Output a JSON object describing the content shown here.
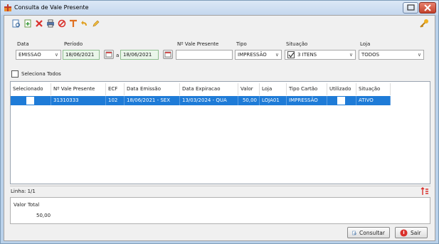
{
  "window": {
    "title": "Consulta de Vale Presente"
  },
  "filters": {
    "data_label": "Data",
    "data_value": "EMISSAO",
    "periodo_label": "Período",
    "periodo_start": "18/06/2021",
    "periodo_sep": "a",
    "periodo_end": "18/06/2021",
    "vale_label": "Nº Vale Presente",
    "vale_value": "",
    "tipo_label": "Tipo",
    "tipo_value": "IMPRESSÃO",
    "situacao_label": "Situação",
    "situacao_value": "3 ITENS",
    "loja_label": "Loja",
    "loja_value": "TODOS"
  },
  "select_all_label": "Seleciona Todos",
  "table": {
    "headers": [
      "Selecionado",
      "Nº Vale Presente",
      "ECF",
      "Data Emissão",
      "Data Expiracao",
      "Valor",
      "Loja",
      "Tipo Cartão",
      "Utilizado",
      "Situação"
    ],
    "rows": [
      {
        "vale": "31310333",
        "ecf": "102",
        "emissao": "18/06/2021 - SEX",
        "expiracao": "13/03/2024 - QUA",
        "valor": "50,00",
        "loja": "LOJA01",
        "tipo": "IMPRESSÃO",
        "situacao": "ATIVO"
      }
    ]
  },
  "status": {
    "linha": "Linha: 1/1"
  },
  "totals": {
    "label": "Valor Total",
    "value": "50,00"
  },
  "buttons": {
    "consultar": "Consultar",
    "sair": "Sair"
  },
  "colors": {
    "selection": "#1e7bd7",
    "accent_red": "#d9302b"
  }
}
